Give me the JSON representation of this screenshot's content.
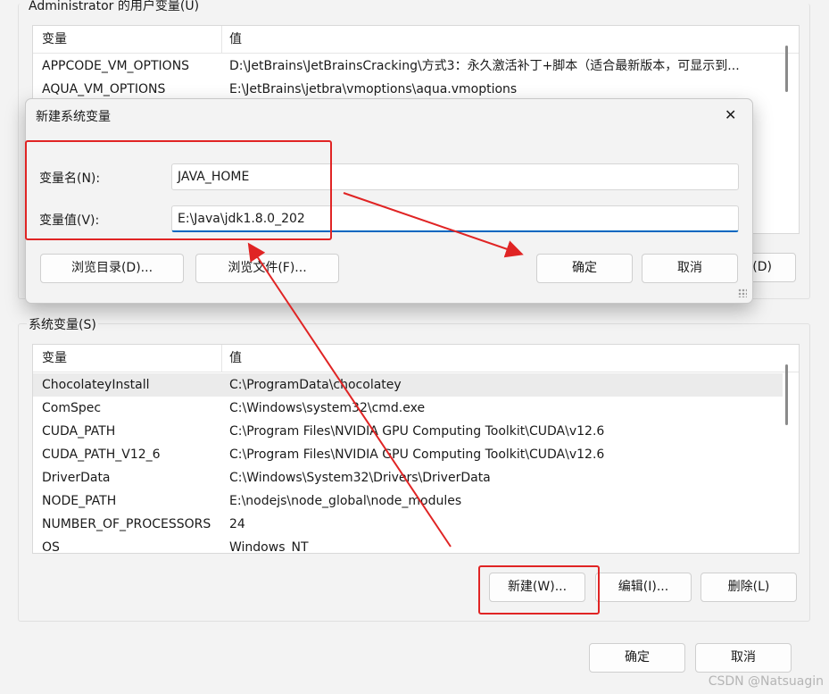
{
  "user_vars": {
    "group_label": "Administrator 的用户变量(U)",
    "columns": [
      "变量",
      "值"
    ],
    "rows": [
      {
        "name": "APPCODE_VM_OPTIONS",
        "value": "D:\\JetBrains\\JetBrainsCracking\\方式3：永久激活补丁+脚本（适合最新版本，可显示到..."
      },
      {
        "name": "AQUA_VM_OPTIONS",
        "value": "E:\\JetBrains\\jetbra\\vmoptions\\aqua.vmoptions"
      }
    ],
    "delete_label_partial": "(D)"
  },
  "dialog": {
    "title": "新建系统变量",
    "close_glyph": "✕",
    "name_label": "变量名(N):",
    "value_label": "变量值(V):",
    "name_value": "JAVA_HOME",
    "value_value": "E:\\Java\\jdk1.8.0_202",
    "browse_dir": "浏览目录(D)...",
    "browse_file": "浏览文件(F)...",
    "ok": "确定",
    "cancel": "取消"
  },
  "system_vars": {
    "group_label": "系统变量(S)",
    "columns": [
      "变量",
      "值"
    ],
    "rows": [
      {
        "name": "ChocolateyInstall",
        "value": "C:\\ProgramData\\chocolatey"
      },
      {
        "name": "ComSpec",
        "value": "C:\\Windows\\system32\\cmd.exe"
      },
      {
        "name": "CUDA_PATH",
        "value": "C:\\Program Files\\NVIDIA GPU Computing Toolkit\\CUDA\\v12.6"
      },
      {
        "name": "CUDA_PATH_V12_6",
        "value": "C:\\Program Files\\NVIDIA GPU Computing Toolkit\\CUDA\\v12.6"
      },
      {
        "name": "DriverData",
        "value": "C:\\Windows\\System32\\Drivers\\DriverData"
      },
      {
        "name": "NODE_PATH",
        "value": "E:\\nodejs\\node_global\\node_modules"
      },
      {
        "name": "NUMBER_OF_PROCESSORS",
        "value": "24"
      },
      {
        "name": "OS",
        "value": "Windows_NT"
      }
    ],
    "new_button": "新建(W)...",
    "edit_button": "编辑(I)...",
    "delete_button": "删除(L)"
  },
  "footer": {
    "ok": "确定",
    "cancel": "取消"
  },
  "watermark": "CSDN @Natsuagin",
  "colors": {
    "annotation_red": "#e02424",
    "focus_blue": "#0067c0",
    "selected_row": "#ebebeb"
  }
}
